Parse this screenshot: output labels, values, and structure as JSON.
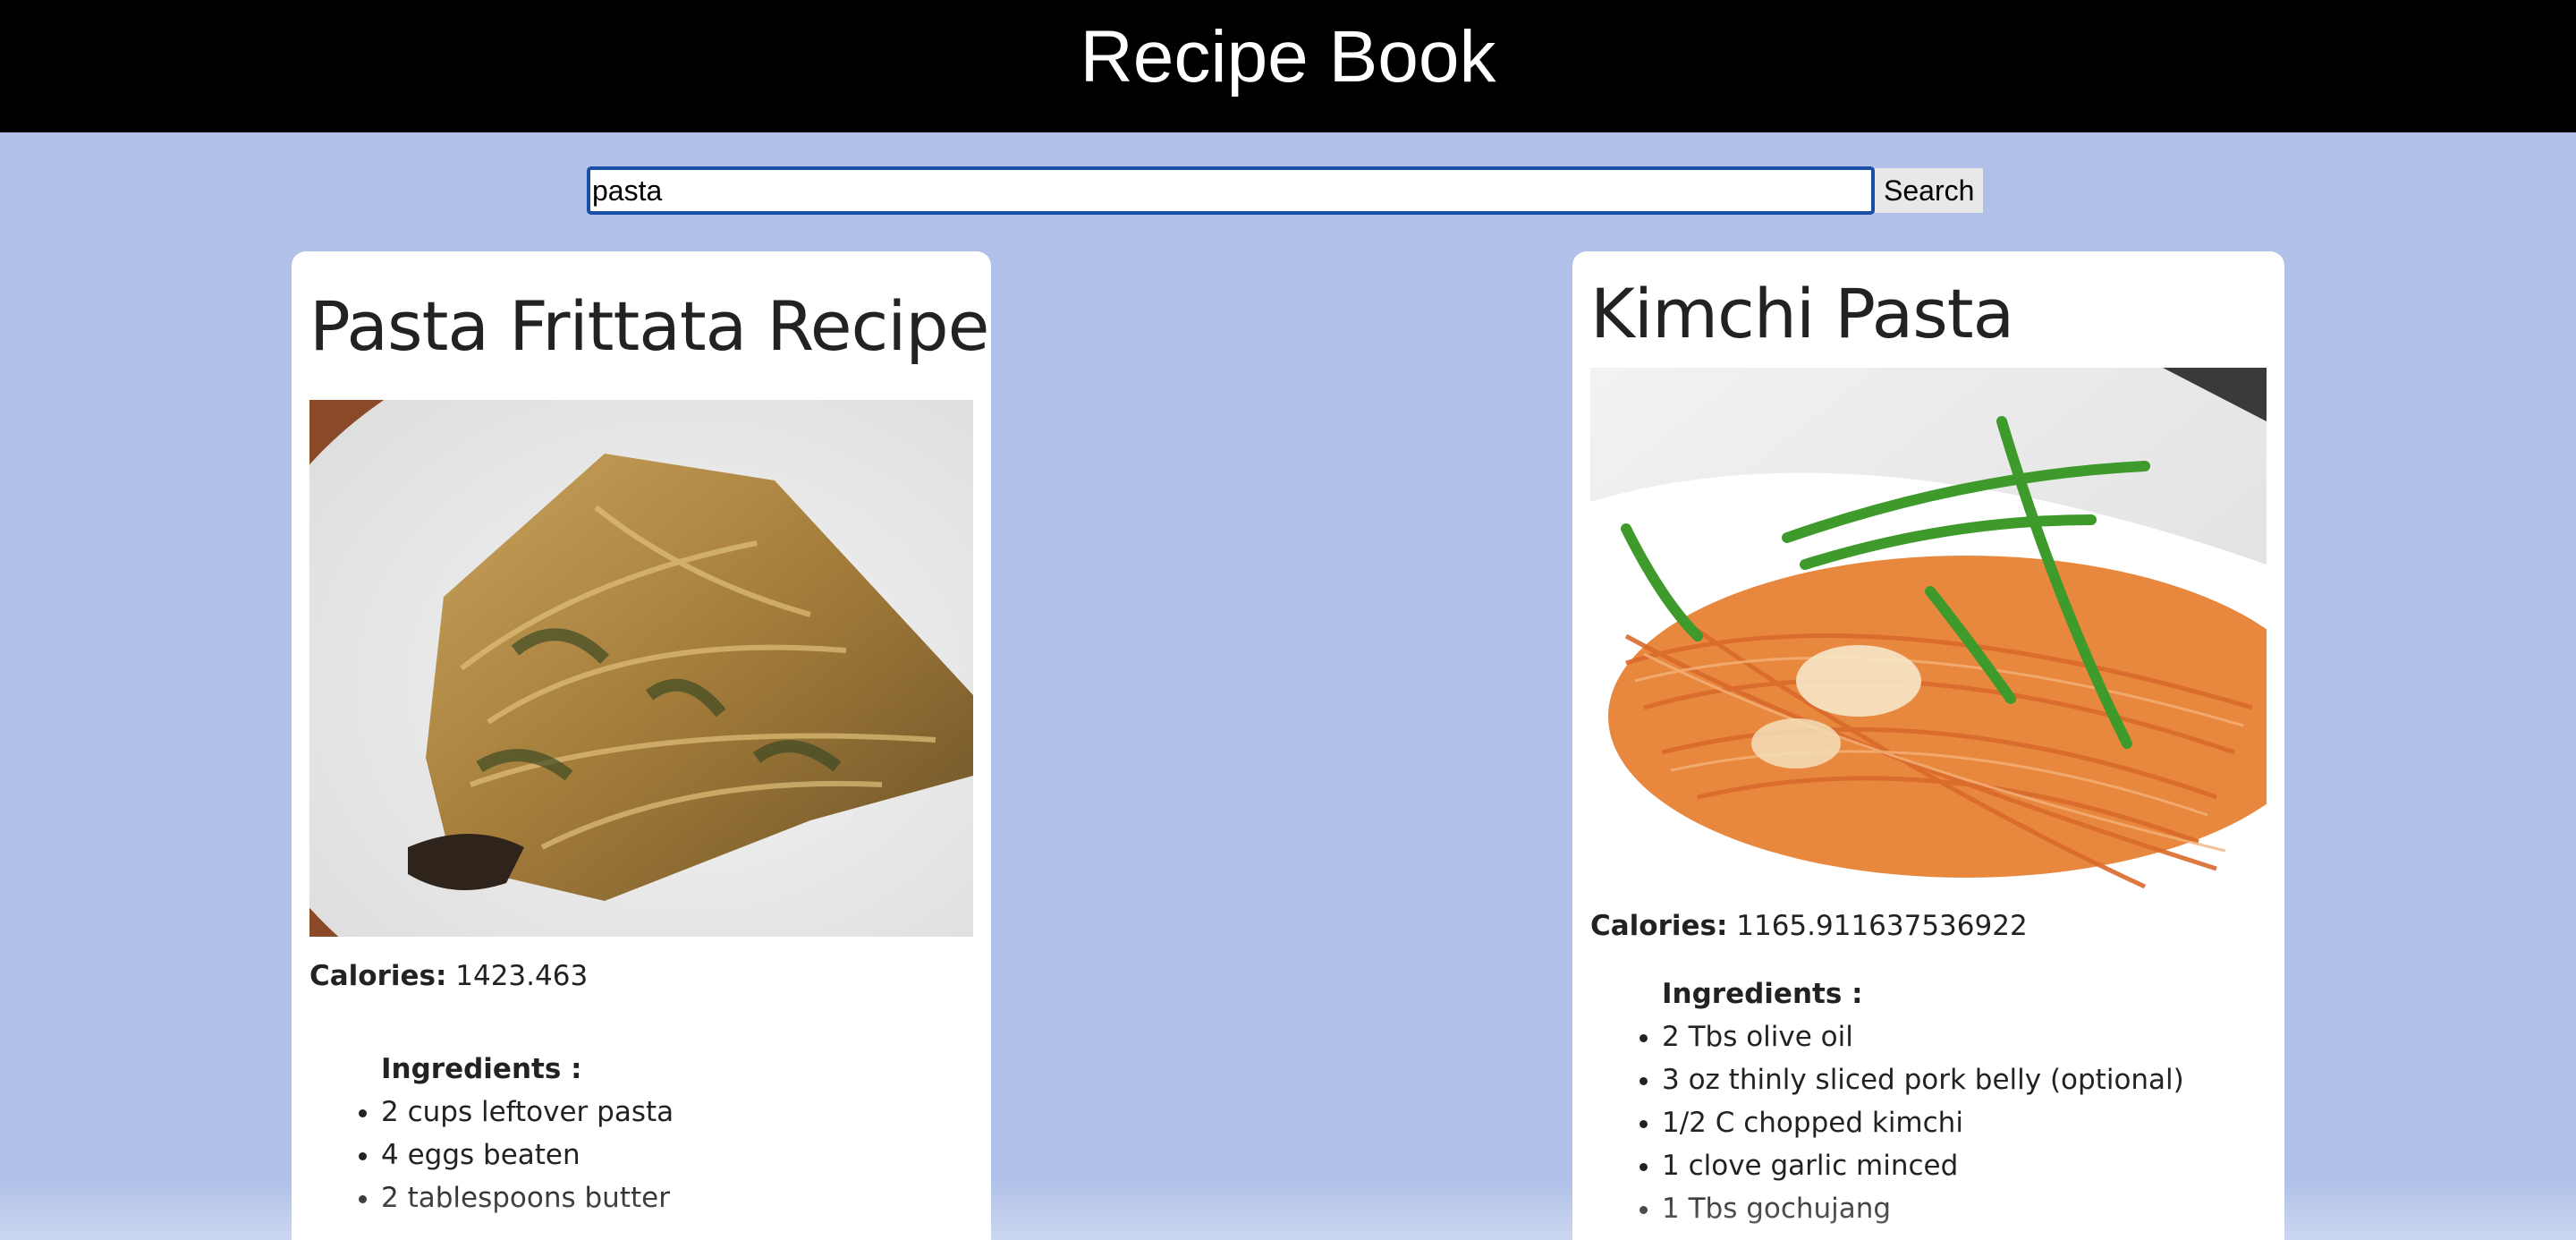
{
  "header": {
    "title": "Recipe Book"
  },
  "search": {
    "value": "pasta",
    "button_label": "Search"
  },
  "recipes": [
    {
      "title": "Pasta Frittata Recipe",
      "calories_label": "Calories:",
      "calories": "1423.463",
      "ingredients_heading": "Ingredients :",
      "ingredients": [
        "2 cups leftover pasta",
        "4 eggs beaten",
        "2 tablespoons butter"
      ]
    },
    {
      "title": "Kimchi Pasta",
      "calories_label": "Calories:",
      "calories": "1165.911637536922",
      "ingredients_heading": "Ingredients :",
      "ingredients": [
        "2 Tbs olive oil",
        "3 oz thinly sliced pork belly (optional)",
        "1/2 C chopped kimchi",
        "1 clove garlic minced",
        "1 Tbs gochujang"
      ]
    }
  ],
  "colors": {
    "page_bg": "#b0c0e8",
    "header_bg": "#000000",
    "input_border": "#1a4fa8"
  }
}
